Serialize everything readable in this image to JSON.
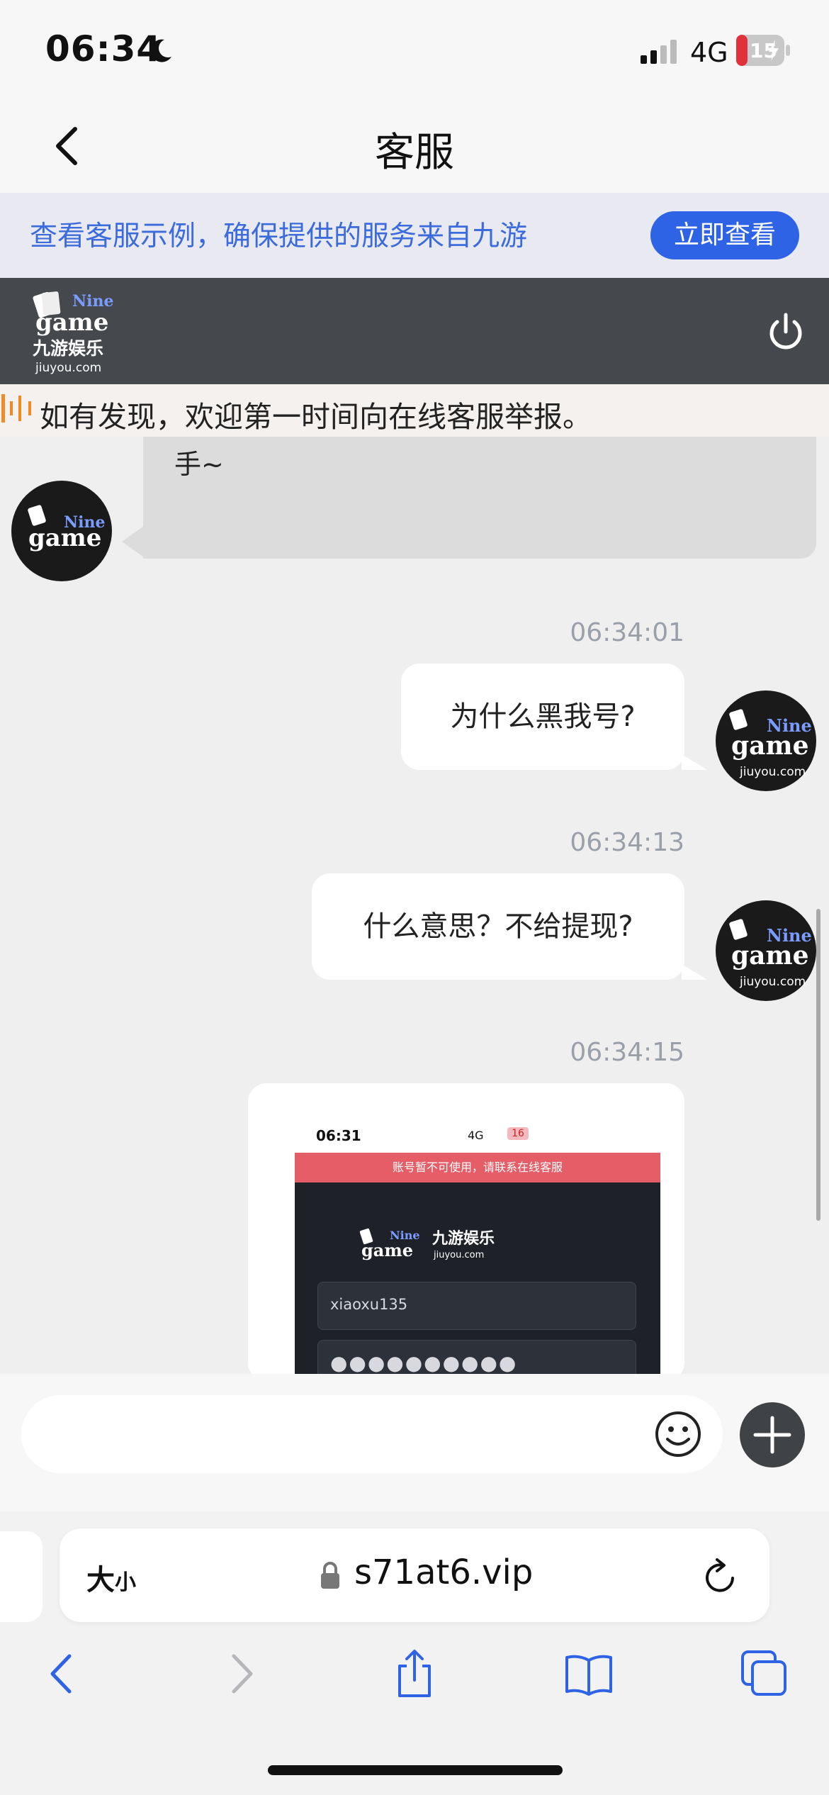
{
  "status_bar": {
    "time": "06:34",
    "network": "4G",
    "battery": "15"
  },
  "nav": {
    "title": "客服"
  },
  "notice": {
    "text": "查看客服示例，确保提供的服务来自九游",
    "button": "立即查看"
  },
  "brand": {
    "logo_text_line1": "Nine",
    "logo_text_line2": "game",
    "logo_cn": "九游娱乐",
    "logo_domain": "jiuyou.com"
  },
  "marquee": {
    "text": "如有发现，欢迎第一时间向在线客服举报。"
  },
  "chat": {
    "agent_partial_text": "手~",
    "messages": [
      {
        "time": "06:34:01",
        "text": "为什么黑我号?"
      },
      {
        "time": "06:34:13",
        "text": "什么意思？不给提现?"
      },
      {
        "time": "06:34:15",
        "text": ""
      }
    ],
    "embedded": {
      "time": "06:31",
      "network": "4G",
      "battery": "16",
      "warning": "账号暂不可使用，请联系在线客服",
      "username": "xiaoxu135",
      "password_mask": "●●●●●●●●●●"
    }
  },
  "input": {
    "placeholder": ""
  },
  "browser": {
    "text_size_label": "大",
    "text_size_small": "小",
    "url": "s71at6.vip"
  }
}
